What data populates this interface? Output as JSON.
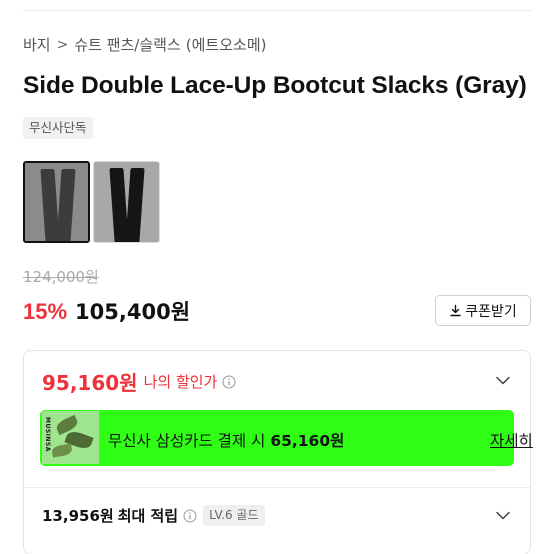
{
  "breadcrumb": {
    "category": "바지",
    "separator": ">",
    "subcategory": "슈트 팬츠/슬랙스",
    "brand": "(에트오소메)"
  },
  "product": {
    "title": "Side Double Lace-Up Bootcut Slacks (Gray)",
    "exclusive_badge": "무신사단독",
    "thumbnails": [
      {
        "name": "gray"
      },
      {
        "name": "black"
      }
    ]
  },
  "pricing": {
    "original_price": "124,000원",
    "discount_rate": "15%",
    "sale_price": "105,400원",
    "coupon_label": "쿠폰받기"
  },
  "benefits": {
    "best_price": "95,160원",
    "best_price_label": "나의 할인가",
    "card_banner": {
      "text_prefix": "무신사 삼성카드 결제 시 ",
      "card_price": "65,160원",
      "link_label": "자세히",
      "image_tag": "MUSINSA"
    },
    "points_amount": "13,956원",
    "points_label": "최대 적립",
    "member_level": "LV.6 골드"
  },
  "colors": {
    "discount_red": "#f0313a",
    "banner_green": "#2fff14"
  }
}
